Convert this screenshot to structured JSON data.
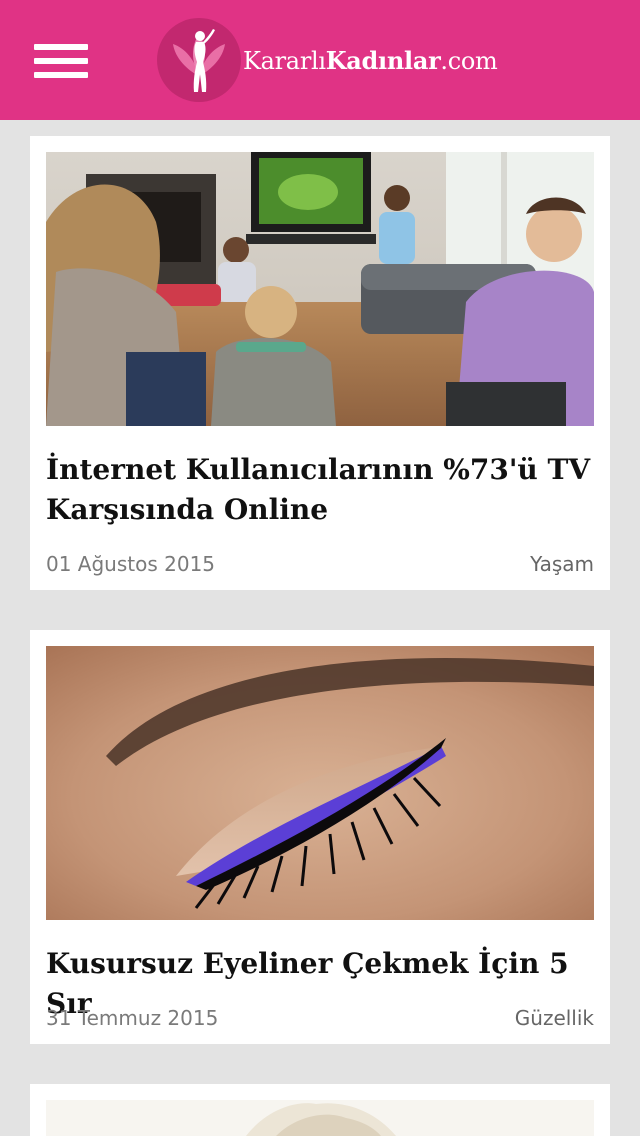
{
  "header": {
    "brand_light": "Kararlı",
    "brand_bold": "Kadınlar",
    "brand_suffix": ".com",
    "menu_icon": "hamburger-menu-icon",
    "logo_icon": "woman-lotus-logo"
  },
  "colors": {
    "header_bg": "#e03385",
    "page_bg": "#e3e3e3",
    "card_bg": "#ffffff"
  },
  "articles": [
    {
      "title": "İnternet Kullanıcılarının %73'ü TV Karşısında Online",
      "date": "01 Ağustos 2015",
      "category": "Yaşam",
      "image": "family-watching-tv-photo"
    },
    {
      "title": "Kusursuz Eyeliner Çekmek İçin 5 Sır",
      "date": "31 Temmuz 2015",
      "category": "Güzellik",
      "image": "eyeliner-closeup-photo"
    },
    {
      "image": "cream-fabric-photo"
    }
  ]
}
